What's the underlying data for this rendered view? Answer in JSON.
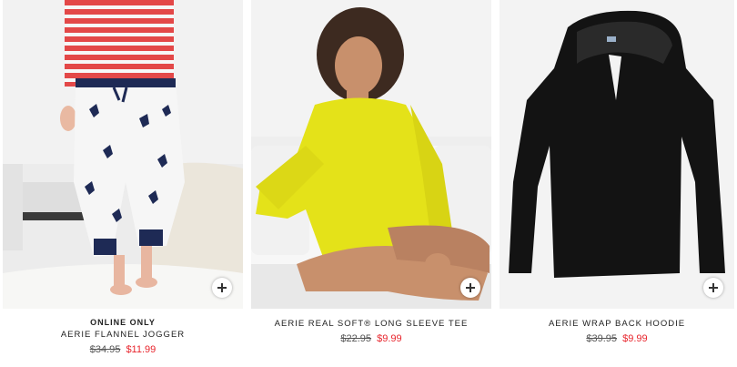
{
  "products": [
    {
      "badge": "ONLINE ONLY",
      "name": "AERIE FLANNEL JOGGER",
      "was_price": "$34.95",
      "sale_price": "$11.99",
      "image_icon": "flannel-jogger-photo"
    },
    {
      "badge": "",
      "name": "AERIE REAL SOFT® LONG SLEEVE TEE",
      "was_price": "$22.95",
      "sale_price": "$9.99",
      "image_icon": "long-sleeve-tee-photo"
    },
    {
      "badge": "",
      "name": "AERIE WRAP BACK HOODIE",
      "was_price": "$39.95",
      "sale_price": "$9.99",
      "image_icon": "wrap-back-hoodie-photo"
    }
  ],
  "quick_add_icon": "plus-icon",
  "colors": {
    "sale_price": "#e8242c",
    "was_price": "#555555",
    "text": "#222222"
  }
}
